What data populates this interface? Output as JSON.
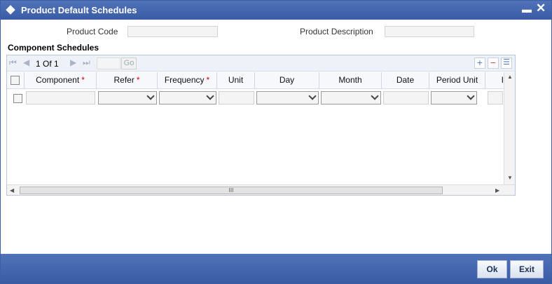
{
  "window": {
    "title": "Product Default Schedules",
    "minimize_glyph": "▬",
    "close_glyph": "✕"
  },
  "header": {
    "product_code_label": "Product Code",
    "product_code_value": "",
    "product_description_label": "Product Description",
    "product_description_value": ""
  },
  "grid": {
    "section_title": "Component Schedules",
    "pager": {
      "first": "⏮",
      "prev": "◀",
      "page_text": "1 Of 1",
      "next": "▶",
      "last": "⏭",
      "page_input": "",
      "go_label": "Go"
    },
    "toolbar": {
      "add": "+",
      "remove": "−",
      "view": "☰"
    },
    "columns": [
      {
        "label": "Component",
        "required": true
      },
      {
        "label": "Refer",
        "required": true
      },
      {
        "label": "Frequency",
        "required": true
      },
      {
        "label": "Unit",
        "required": false
      },
      {
        "label": "Day",
        "required": false
      },
      {
        "label": "Month",
        "required": false
      },
      {
        "label": "Date",
        "required": false
      },
      {
        "label": "Period Unit",
        "required": false
      },
      {
        "label": "I",
        "required": false
      }
    ],
    "required_marker": "*",
    "scroll_grip": "III"
  },
  "footer": {
    "ok_label": "Ok",
    "exit_label": "Exit"
  },
  "colors": {
    "titlebar": "#3a5ca6",
    "required": "#dd0000"
  }
}
